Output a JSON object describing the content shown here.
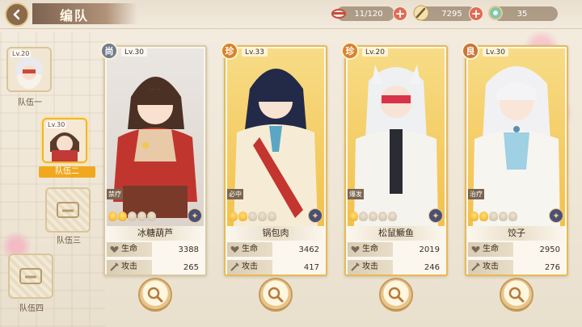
{
  "header": {
    "title": "编队",
    "stamina": "11/120",
    "coins": "7295",
    "gems": "35"
  },
  "teams": [
    {
      "label": "队伍一",
      "level": "Lv.20",
      "filled": true,
      "active": false
    },
    {
      "label": "队伍二",
      "level": "Lv.30",
      "filled": true,
      "active": true
    },
    {
      "label": "队伍三",
      "filled": false,
      "active": false
    },
    {
      "label": "队伍四",
      "filled": false,
      "active": false
    }
  ],
  "stat_labels": {
    "hp": "生命",
    "atk": "攻击"
  },
  "cards": [
    {
      "name": "冰糖葫芦",
      "rank": "尚",
      "level": "Lv.30",
      "role": "禁疗",
      "hp": "3388",
      "atk": "265",
      "stars": 2,
      "rank_color": "#6f7c8c",
      "frame": "silver",
      "theme": "#c23a36"
    },
    {
      "name": "锅包肉",
      "rank": "珍",
      "level": "Lv.33",
      "role": "必中",
      "hp": "3462",
      "atk": "417",
      "stars": 2,
      "rank_color": "#d9822b",
      "frame": "gold",
      "theme": "#f3ca5b"
    },
    {
      "name": "松鼠鳜鱼",
      "rank": "珍",
      "level": "Lv.20",
      "role": "爆发",
      "hp": "2019",
      "atk": "246",
      "stars": 1,
      "rank_color": "#d9822b",
      "frame": "gold",
      "theme": "#f3ca5b"
    },
    {
      "name": "饺子",
      "rank": "良",
      "level": "Lv.30",
      "role": "治疗",
      "hp": "2950",
      "atk": "276",
      "stars": 2,
      "rank_color": "#c9763a",
      "frame": "gold",
      "theme": "#f3ca5b"
    }
  ],
  "colors": {
    "accent": "#f0a91f",
    "plus": "#e06b55",
    "brown": "#7d6350"
  }
}
